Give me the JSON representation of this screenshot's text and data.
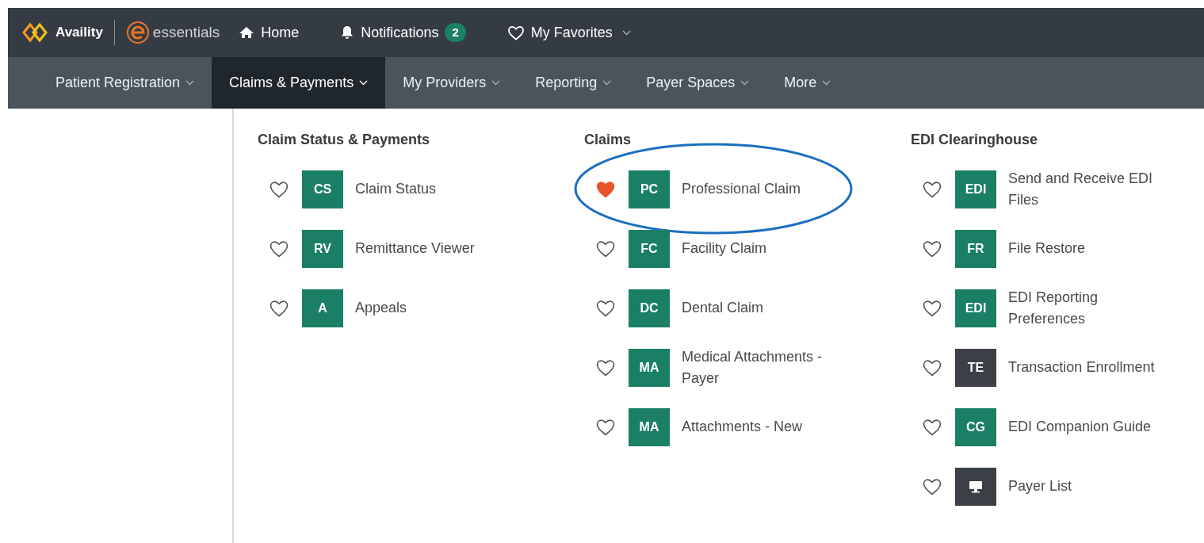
{
  "brand": {
    "name": "Availity",
    "product": "essentials"
  },
  "top_links": [
    {
      "kind": "home",
      "label": "Home"
    },
    {
      "kind": "notifications",
      "label": "Notifications",
      "badge": "2"
    },
    {
      "kind": "favorites",
      "label": "My Favorites"
    }
  ],
  "nav": [
    {
      "label": "Patient Registration",
      "selected": false
    },
    {
      "label": "Claims & Payments",
      "selected": true
    },
    {
      "label": "My Providers",
      "selected": false
    },
    {
      "label": "Reporting",
      "selected": false
    },
    {
      "label": "Payer Spaces",
      "selected": false
    },
    {
      "label": "More",
      "selected": false
    }
  ],
  "menu_columns": [
    {
      "heading": "Claim Status & Payments",
      "items": [
        {
          "tile": "CS",
          "kind": "text",
          "color": "#1a7f64",
          "label": "Claim Status",
          "favorite": false,
          "circled": false
        },
        {
          "tile": "RV",
          "kind": "text",
          "color": "#1a7f64",
          "label": "Remittance Viewer",
          "favorite": false,
          "circled": false
        },
        {
          "tile": "A",
          "kind": "text",
          "color": "#1a7f64",
          "label": "Appeals",
          "favorite": false,
          "circled": false
        }
      ]
    },
    {
      "heading": "Claims",
      "items": [
        {
          "tile": "PC",
          "kind": "text",
          "color": "#1a7f64",
          "label": "Professional Claim",
          "favorite": true,
          "circled": true
        },
        {
          "tile": "FC",
          "kind": "text",
          "color": "#1a7f64",
          "label": "Facility Claim",
          "favorite": false,
          "circled": false
        },
        {
          "tile": "DC",
          "kind": "text",
          "color": "#1a7f64",
          "label": "Dental Claim",
          "favorite": false,
          "circled": false
        },
        {
          "tile": "MA",
          "kind": "text",
          "color": "#1a7f64",
          "label": "Medical Attachments - Payer",
          "favorite": false,
          "circled": false
        },
        {
          "tile": "MA",
          "kind": "text",
          "color": "#1a7f64",
          "label": "Attachments - New",
          "favorite": false,
          "circled": false
        }
      ]
    },
    {
      "heading": "EDI Clearinghouse",
      "items": [
        {
          "tile": "EDI",
          "kind": "text",
          "color": "#1a7f64",
          "label": "Send and Receive EDI Files",
          "favorite": false,
          "circled": false
        },
        {
          "tile": "FR",
          "kind": "text",
          "color": "#1a7f64",
          "label": "File Restore",
          "favorite": false,
          "circled": false
        },
        {
          "tile": "EDI",
          "kind": "text",
          "color": "#1a7f64",
          "label": "EDI Reporting Preferences",
          "favorite": false,
          "circled": false
        },
        {
          "tile": "TE",
          "kind": "text",
          "color": "#3a4045",
          "label": "Transaction Enrollment",
          "favorite": false,
          "circled": false
        },
        {
          "tile": "CG",
          "kind": "text",
          "color": "#1a7f64",
          "label": "EDI Companion Guide",
          "favorite": false,
          "circled": false
        },
        {
          "kind": "monitor",
          "color": "#3a4045",
          "label": "Payer List",
          "favorite": false,
          "circled": false
        }
      ]
    }
  ]
}
